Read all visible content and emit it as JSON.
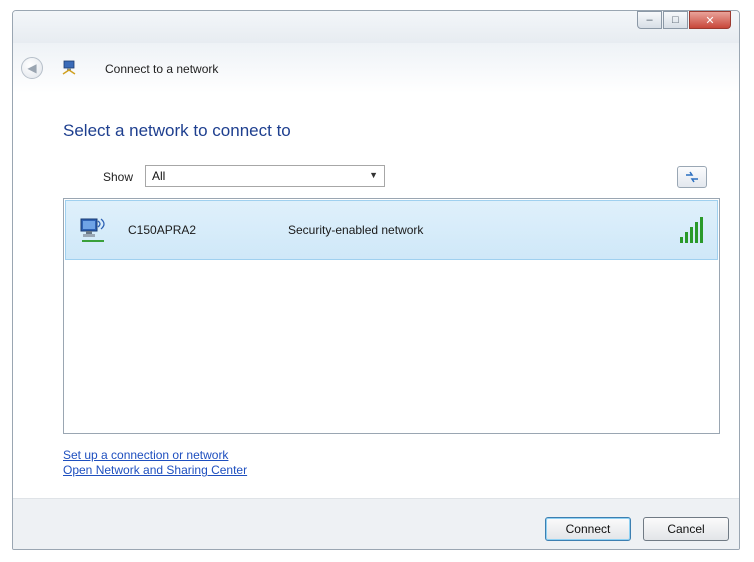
{
  "window": {
    "title": "Connect to a network",
    "controls": {
      "minimize": "–",
      "maximize": "□",
      "close": "✕"
    }
  },
  "main": {
    "heading": "Select a network to connect to",
    "show_label": "Show",
    "show_value": "All"
  },
  "networks": [
    {
      "name": "C150APRA2",
      "status": "Security-enabled network",
      "signal_bars": 5,
      "signal_level": 1.0
    }
  ],
  "links": {
    "setup": "Set up a connection or network",
    "sharing_center": "Open Network and Sharing Center"
  },
  "buttons": {
    "connect": "Connect",
    "cancel": "Cancel"
  },
  "colors": {
    "heading": "#1e3f8f",
    "link": "#1e4fbf",
    "selected_row": "#d6ecf9",
    "signal": "#2a9a2a"
  }
}
